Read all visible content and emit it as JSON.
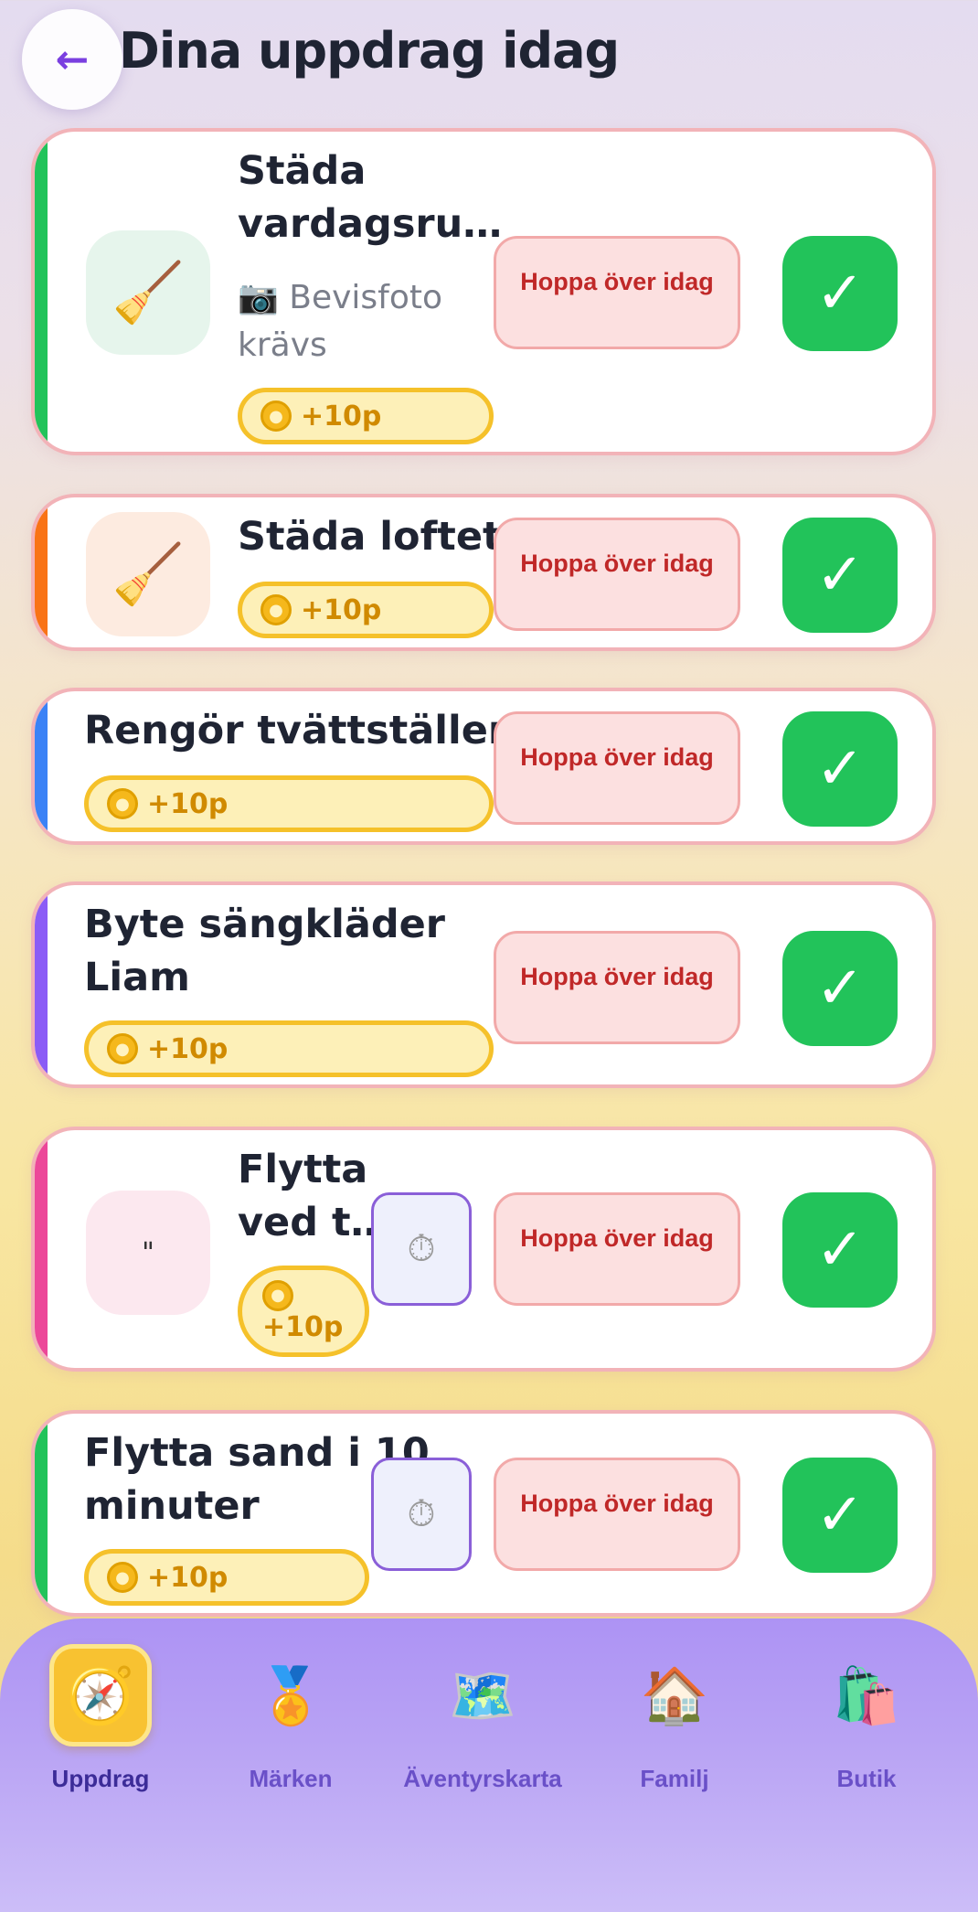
{
  "header": {
    "back_icon": "←",
    "title": "Dina uppdrag idag"
  },
  "tasks": [
    {
      "title": "Städa vardagsru…",
      "title_line1": "Städa",
      "title_line2": "vardagsru…",
      "icon": "🧹",
      "icon_bg": "#e6f5ec",
      "stripe_color": "#22c35a",
      "proof_line1": "📷 Bevisfoto",
      "proof_line2": "krävs",
      "points": "+10p",
      "skip_label": "Hoppa över idag",
      "done_icon": "✓"
    },
    {
      "title": "Städa loftet",
      "icon": "🧹",
      "icon_bg": "#fdebe0",
      "stripe_color": "#f97316",
      "points": "+10p",
      "skip_label": "Hoppa över idag",
      "done_icon": "✓"
    },
    {
      "title": "Rengör tvättställen",
      "stripe_color": "#3b82f6",
      "points": "+10p",
      "skip_label": "Hoppa över idag",
      "done_icon": "✓"
    },
    {
      "title_line1": "Byte sängkläder",
      "title_line2": "Liam",
      "stripe_color": "#8b5cf6",
      "points": "+10p",
      "skip_label": "Hoppa över idag",
      "done_icon": "✓"
    },
    {
      "title_line1": "Flytta",
      "title_line2": "ved t…",
      "icon": "\"",
      "icon_bg": "#fce8ef",
      "stripe_color": "#ec4899",
      "timer_icon": "⏱",
      "points": "+10p",
      "skip_label": "Hoppa över idag",
      "done_icon": "✓"
    },
    {
      "title_line1": "Flytta sand i 10",
      "title_line2": "minuter",
      "stripe_color": "#22c35a",
      "timer_icon": "⏱",
      "points": "+10p",
      "skip_label": "Hoppa över idag",
      "done_icon": "✓"
    }
  ],
  "nav": [
    {
      "label": "Uppdrag",
      "icon": "🧭",
      "active": true
    },
    {
      "label": "Märken",
      "icon": "🏅",
      "active": false
    },
    {
      "label": "Äventyrskarta",
      "icon": "🗺️",
      "active": false
    },
    {
      "label": "Familj",
      "icon": "🏠",
      "active": false
    },
    {
      "label": "Butik",
      "icon": "🛍️",
      "active": false
    }
  ]
}
